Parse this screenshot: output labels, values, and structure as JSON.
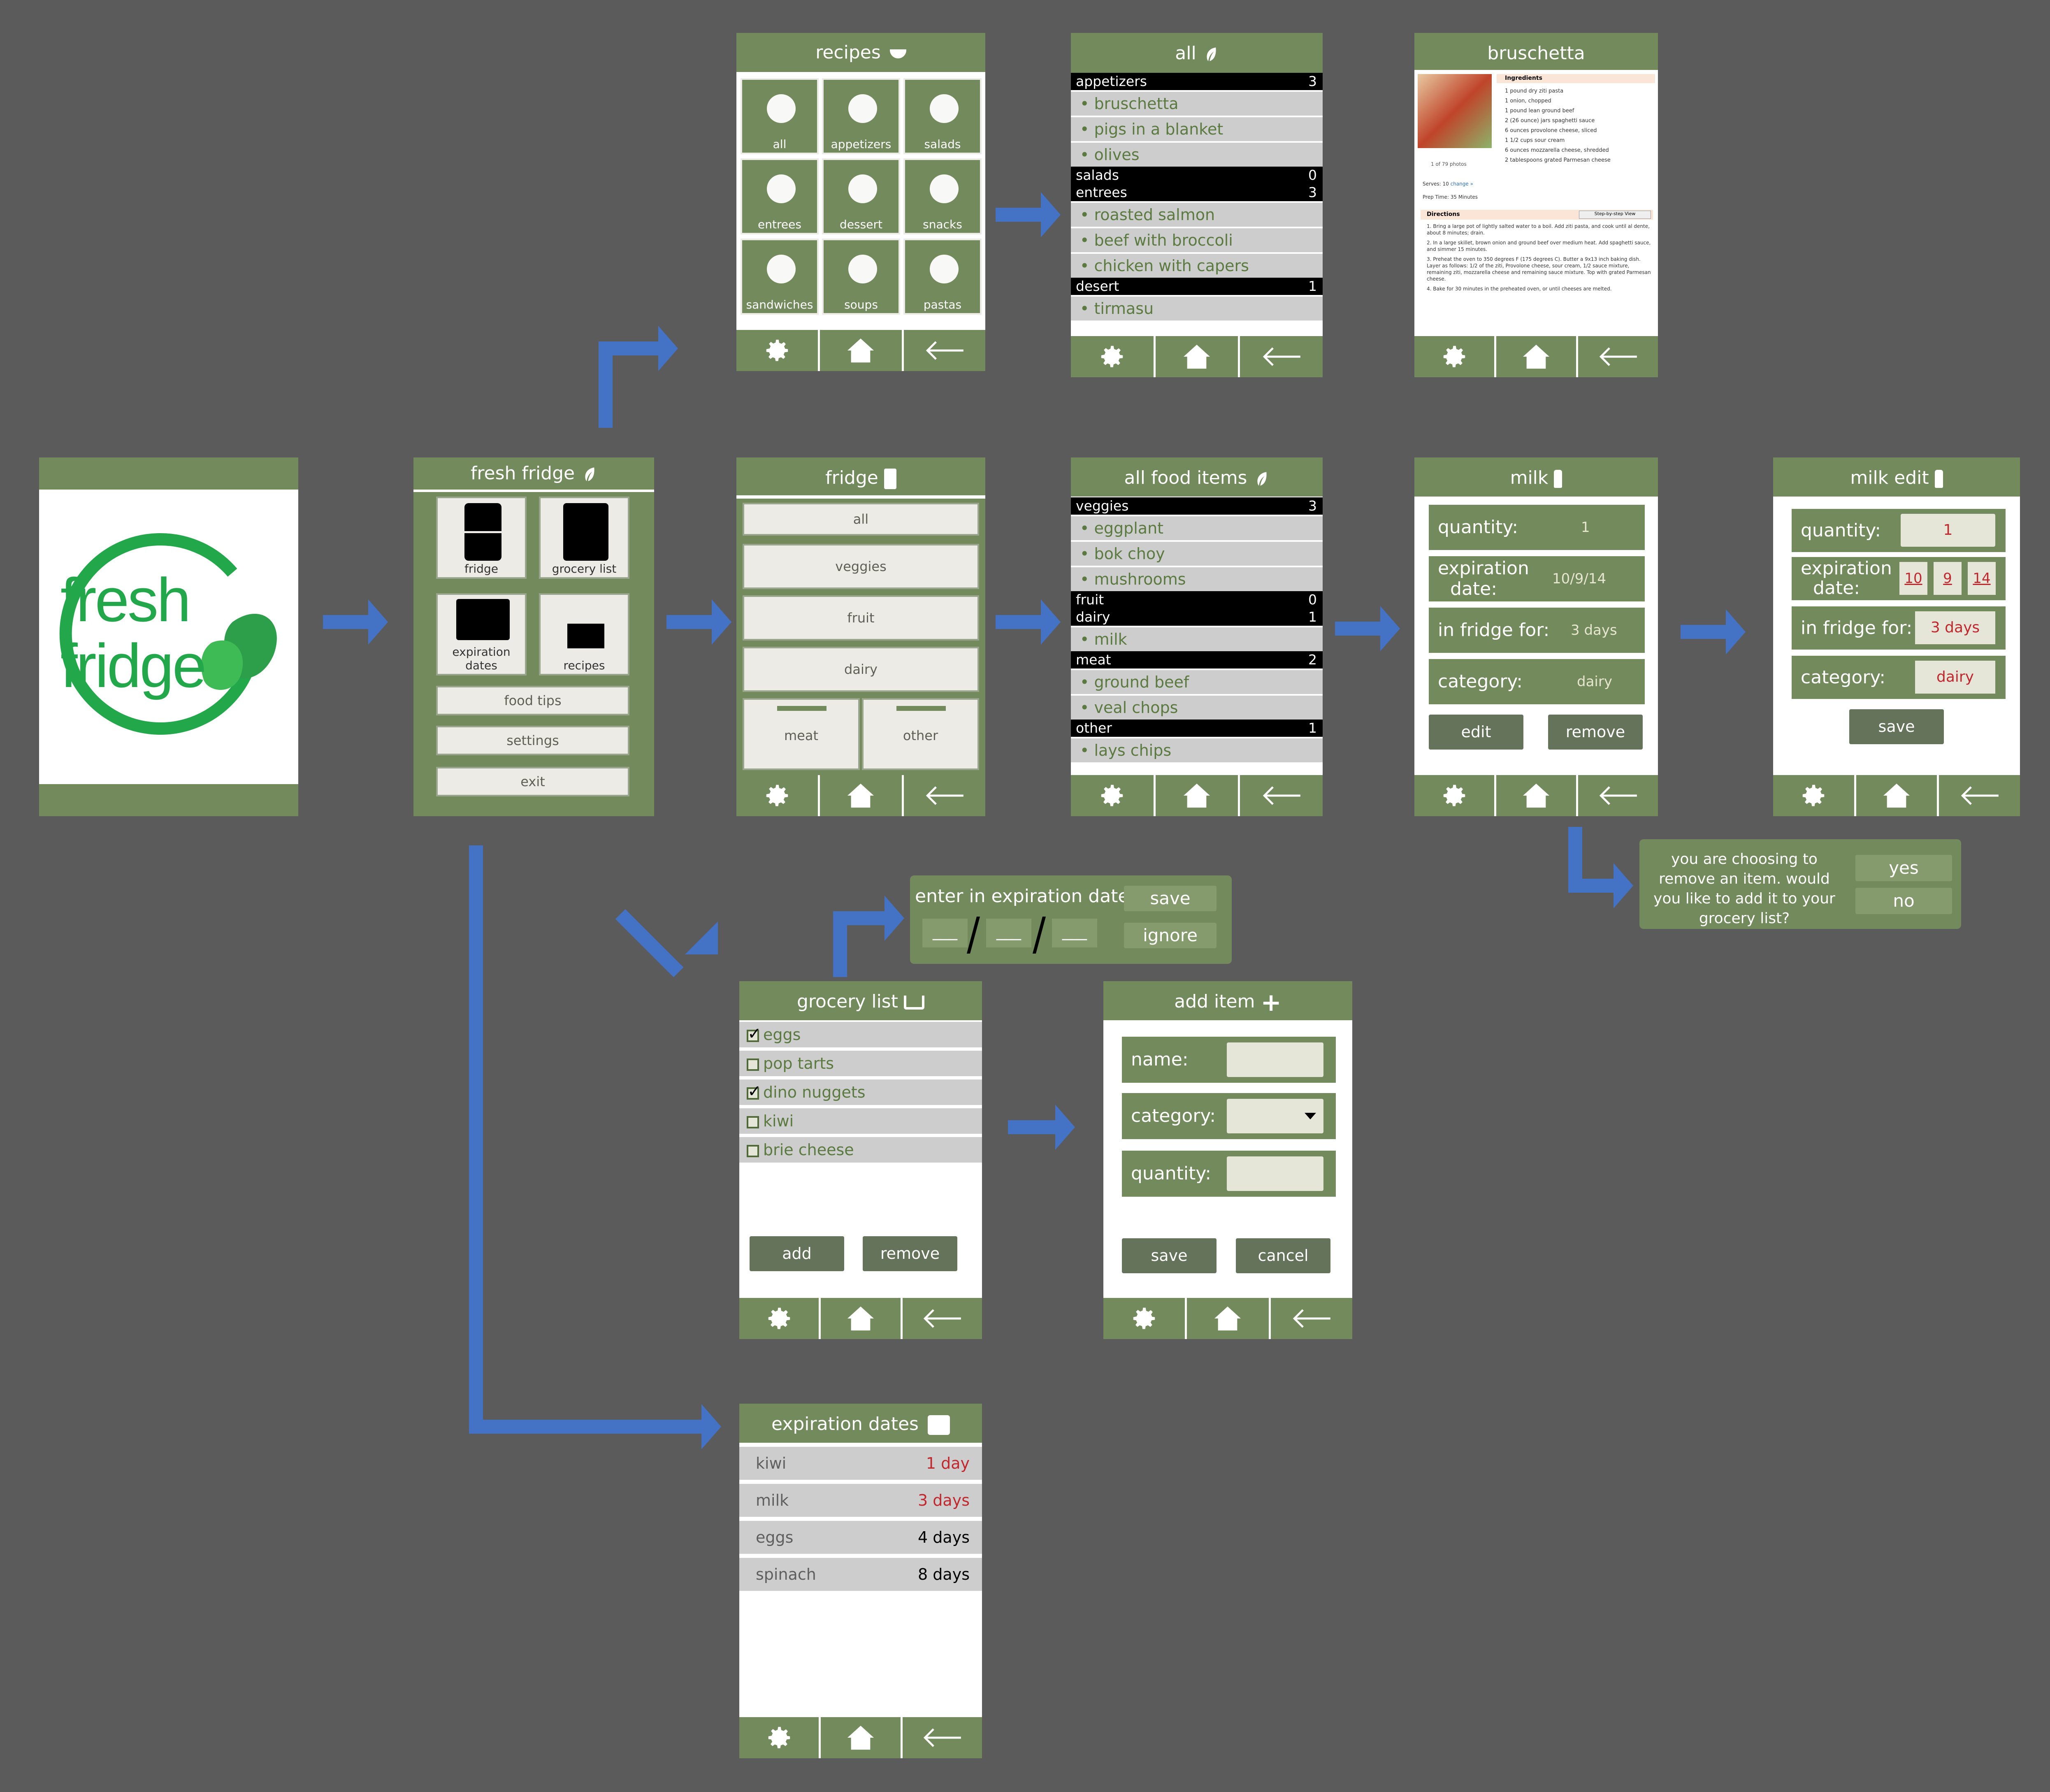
{
  "logo": {
    "line1": "fresh",
    "line2": "fridge"
  },
  "home": {
    "title": "fresh fridge",
    "tiles": [
      "fridge",
      "grocery list",
      "expiration\ndates",
      "recipes"
    ],
    "buttons": [
      "food tips",
      "settings",
      "exit"
    ]
  },
  "recipes": {
    "title": "recipes",
    "tiles": [
      "all",
      "appetizers",
      "salads",
      "entrees",
      "dessert",
      "snacks",
      "sandwiches",
      "soups",
      "pastas"
    ]
  },
  "all_recipes": {
    "title": "all",
    "sections": [
      {
        "name": "appetizers",
        "count": "3",
        "items": [
          "bruschetta",
          "pigs in a blanket",
          "olives"
        ]
      },
      {
        "name": "salads",
        "count": "0",
        "items": []
      },
      {
        "name": "entrees",
        "count": "3",
        "items": [
          "roasted salmon",
          "beef with broccoli",
          "chicken with capers"
        ]
      },
      {
        "name": "desert",
        "count": "1",
        "items": [
          "tirmasu"
        ]
      }
    ]
  },
  "bruschetta": {
    "title": "bruschetta",
    "ingredients_title": "Ingredients",
    "ingredients": [
      "1 pound dry ziti pasta",
      "1 onion, chopped",
      "1 pound lean ground beef",
      "2 (26 ounce) jars spaghetti sauce",
      "6 ounces provolone cheese, sliced",
      "1 1/2 cups sour cream",
      "6 ounces mozzarella cheese, shredded",
      "2 tablespoons grated Parmesan cheese"
    ],
    "photos": "1 of 79 photos",
    "serves": "Serves: 10",
    "serves_link": "change »",
    "prep": "Prep Time: 35 Minutes",
    "directions_title": "Directions",
    "step_view": "Step-by-step View",
    "directions": [
      "Bring a large pot of lightly salted water to a boil. Add ziti pasta, and cook until al dente, about 8 minutes; drain.",
      "In a large skillet, brown onion and ground beef over medium heat. Add spaghetti sauce, and simmer 15 minutes.",
      "Preheat the oven to 350 degrees F (175 degrees C). Butter a 9x13 inch baking dish. Layer as follows: 1/2 of the ziti, Provolone cheese, sour cream, 1/2 sauce mixture, remaining ziti, mozzarella cheese and remaining sauce mixture. Top with grated Parmesan cheese.",
      "Bake for 30 minutes in the preheated oven, or until cheeses are melted."
    ]
  },
  "fridge": {
    "title": "fridge",
    "buttons": [
      "all",
      "veggies",
      "fruit",
      "dairy"
    ],
    "drawers": [
      "meat",
      "other"
    ]
  },
  "all_food": {
    "title": "all food items",
    "sections": [
      {
        "name": "veggies",
        "count": "3",
        "items": [
          "eggplant",
          "bok choy",
          "mushrooms"
        ]
      },
      {
        "name": "fruit",
        "count": "0",
        "items": []
      },
      {
        "name": "dairy",
        "count": "1",
        "items": [
          "milk"
        ]
      },
      {
        "name": "meat",
        "count": "2",
        "items": [
          "ground beef",
          "veal chops"
        ]
      },
      {
        "name": "other",
        "count": "1",
        "items": [
          "lays chips"
        ]
      }
    ]
  },
  "milk": {
    "title": "milk",
    "quantity_label": "quantity:",
    "quantity": "1",
    "exp_label1": "expiration",
    "exp_label2": "date:",
    "exp": "10/9/14",
    "fridge_label": "in fridge for:",
    "fridge": "3 days",
    "category_label": "category:",
    "category": "dairy",
    "edit": "edit",
    "remove": "remove"
  },
  "milk_edit": {
    "title": "milk edit",
    "quantity_label": "quantity:",
    "quantity": "1",
    "exp_label1": "expiration",
    "exp_label2": "date:",
    "exp_m": "10",
    "exp_d": "9",
    "exp_y": "14",
    "fridge_label": "in fridge for:",
    "fridge": "3 days",
    "category_label": "category:",
    "category": "dairy",
    "save": "save"
  },
  "remove_dialog": {
    "text": "you are choosing to remove an item. would you like to add it to your grocery list?",
    "yes": "yes",
    "no": "no"
  },
  "exp_dialog": {
    "label": "enter in expiration date :",
    "save": "save",
    "ignore": "ignore",
    "blank": "___"
  },
  "grocery": {
    "title": "grocery list",
    "items": [
      {
        "label": "eggs",
        "checked": true
      },
      {
        "label": "pop tarts",
        "checked": false
      },
      {
        "label": "dino nuggets",
        "checked": true
      },
      {
        "label": "kiwi",
        "checked": false
      },
      {
        "label": "brie cheese",
        "checked": false
      }
    ],
    "add": "add",
    "remove": "remove"
  },
  "add_item": {
    "title": "add item",
    "name_label": "name:",
    "category_label": "category:",
    "quantity_label": "quantity:",
    "save": "save",
    "cancel": "cancel"
  },
  "expiration": {
    "title": "expiration dates",
    "items": [
      {
        "name": "kiwi",
        "days": "1 day",
        "urgent": true
      },
      {
        "name": "milk",
        "days": "3 days",
        "urgent": true
      },
      {
        "name": "eggs",
        "days": "4 days",
        "urgent": false
      },
      {
        "name": "spinach",
        "days": "8 days",
        "urgent": false
      }
    ]
  },
  "colors": {
    "primary": "#738a5c",
    "dark_button": "#65735a",
    "arrow": "#4472c4",
    "background": "#5b5b5b",
    "logo_green": "#22a84a",
    "alert": "#c1272d"
  }
}
